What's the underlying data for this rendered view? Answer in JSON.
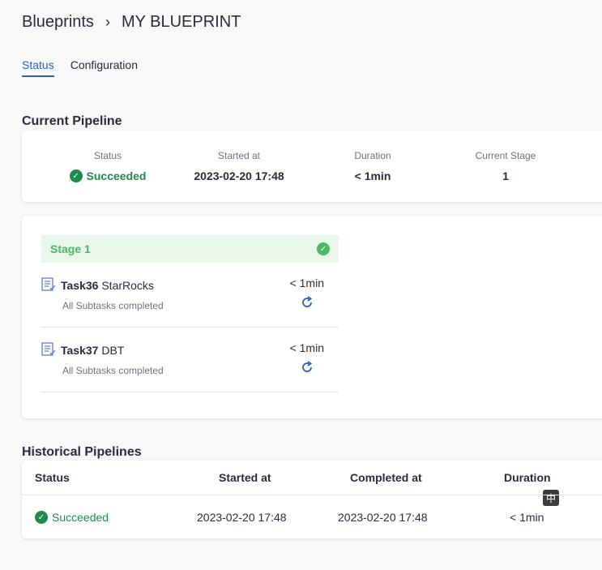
{
  "breadcrumb": {
    "root": "Blueprints",
    "separator": "›",
    "current": "MY BLUEPRINT"
  },
  "tabs": [
    {
      "label": "Status",
      "active": true
    },
    {
      "label": "Configuration",
      "active": false
    }
  ],
  "current_pipeline": {
    "title": "Current Pipeline",
    "status_label": "Status",
    "status_value": "Succeeded",
    "started_label": "Started at",
    "started_value": "2023-02-20 17:48",
    "duration_label": "Duration",
    "duration_value": "< 1min",
    "stage_label": "Current Stage",
    "stage_value": "1"
  },
  "stage": {
    "name": "Stage 1",
    "tasks": [
      {
        "id": "Task36",
        "plugin": "StarRocks",
        "subtitle": "All Subtasks completed",
        "duration": "< 1min"
      },
      {
        "id": "Task37",
        "plugin": "DBT",
        "subtitle": "All Subtasks completed",
        "duration": "< 1min"
      }
    ]
  },
  "historical": {
    "title": "Historical Pipelines",
    "columns": [
      "Status",
      "Started at",
      "Completed at",
      "Duration"
    ],
    "rows": [
      {
        "status": "Succeeded",
        "started": "2023-02-20 17:48",
        "completed": "2023-02-20 17:48",
        "duration": "< 1min"
      }
    ],
    "ime_badge": "中"
  },
  "colors": {
    "accent": "#2a61b6",
    "success": "#1f8a4c",
    "stage_success": "#4db764"
  }
}
